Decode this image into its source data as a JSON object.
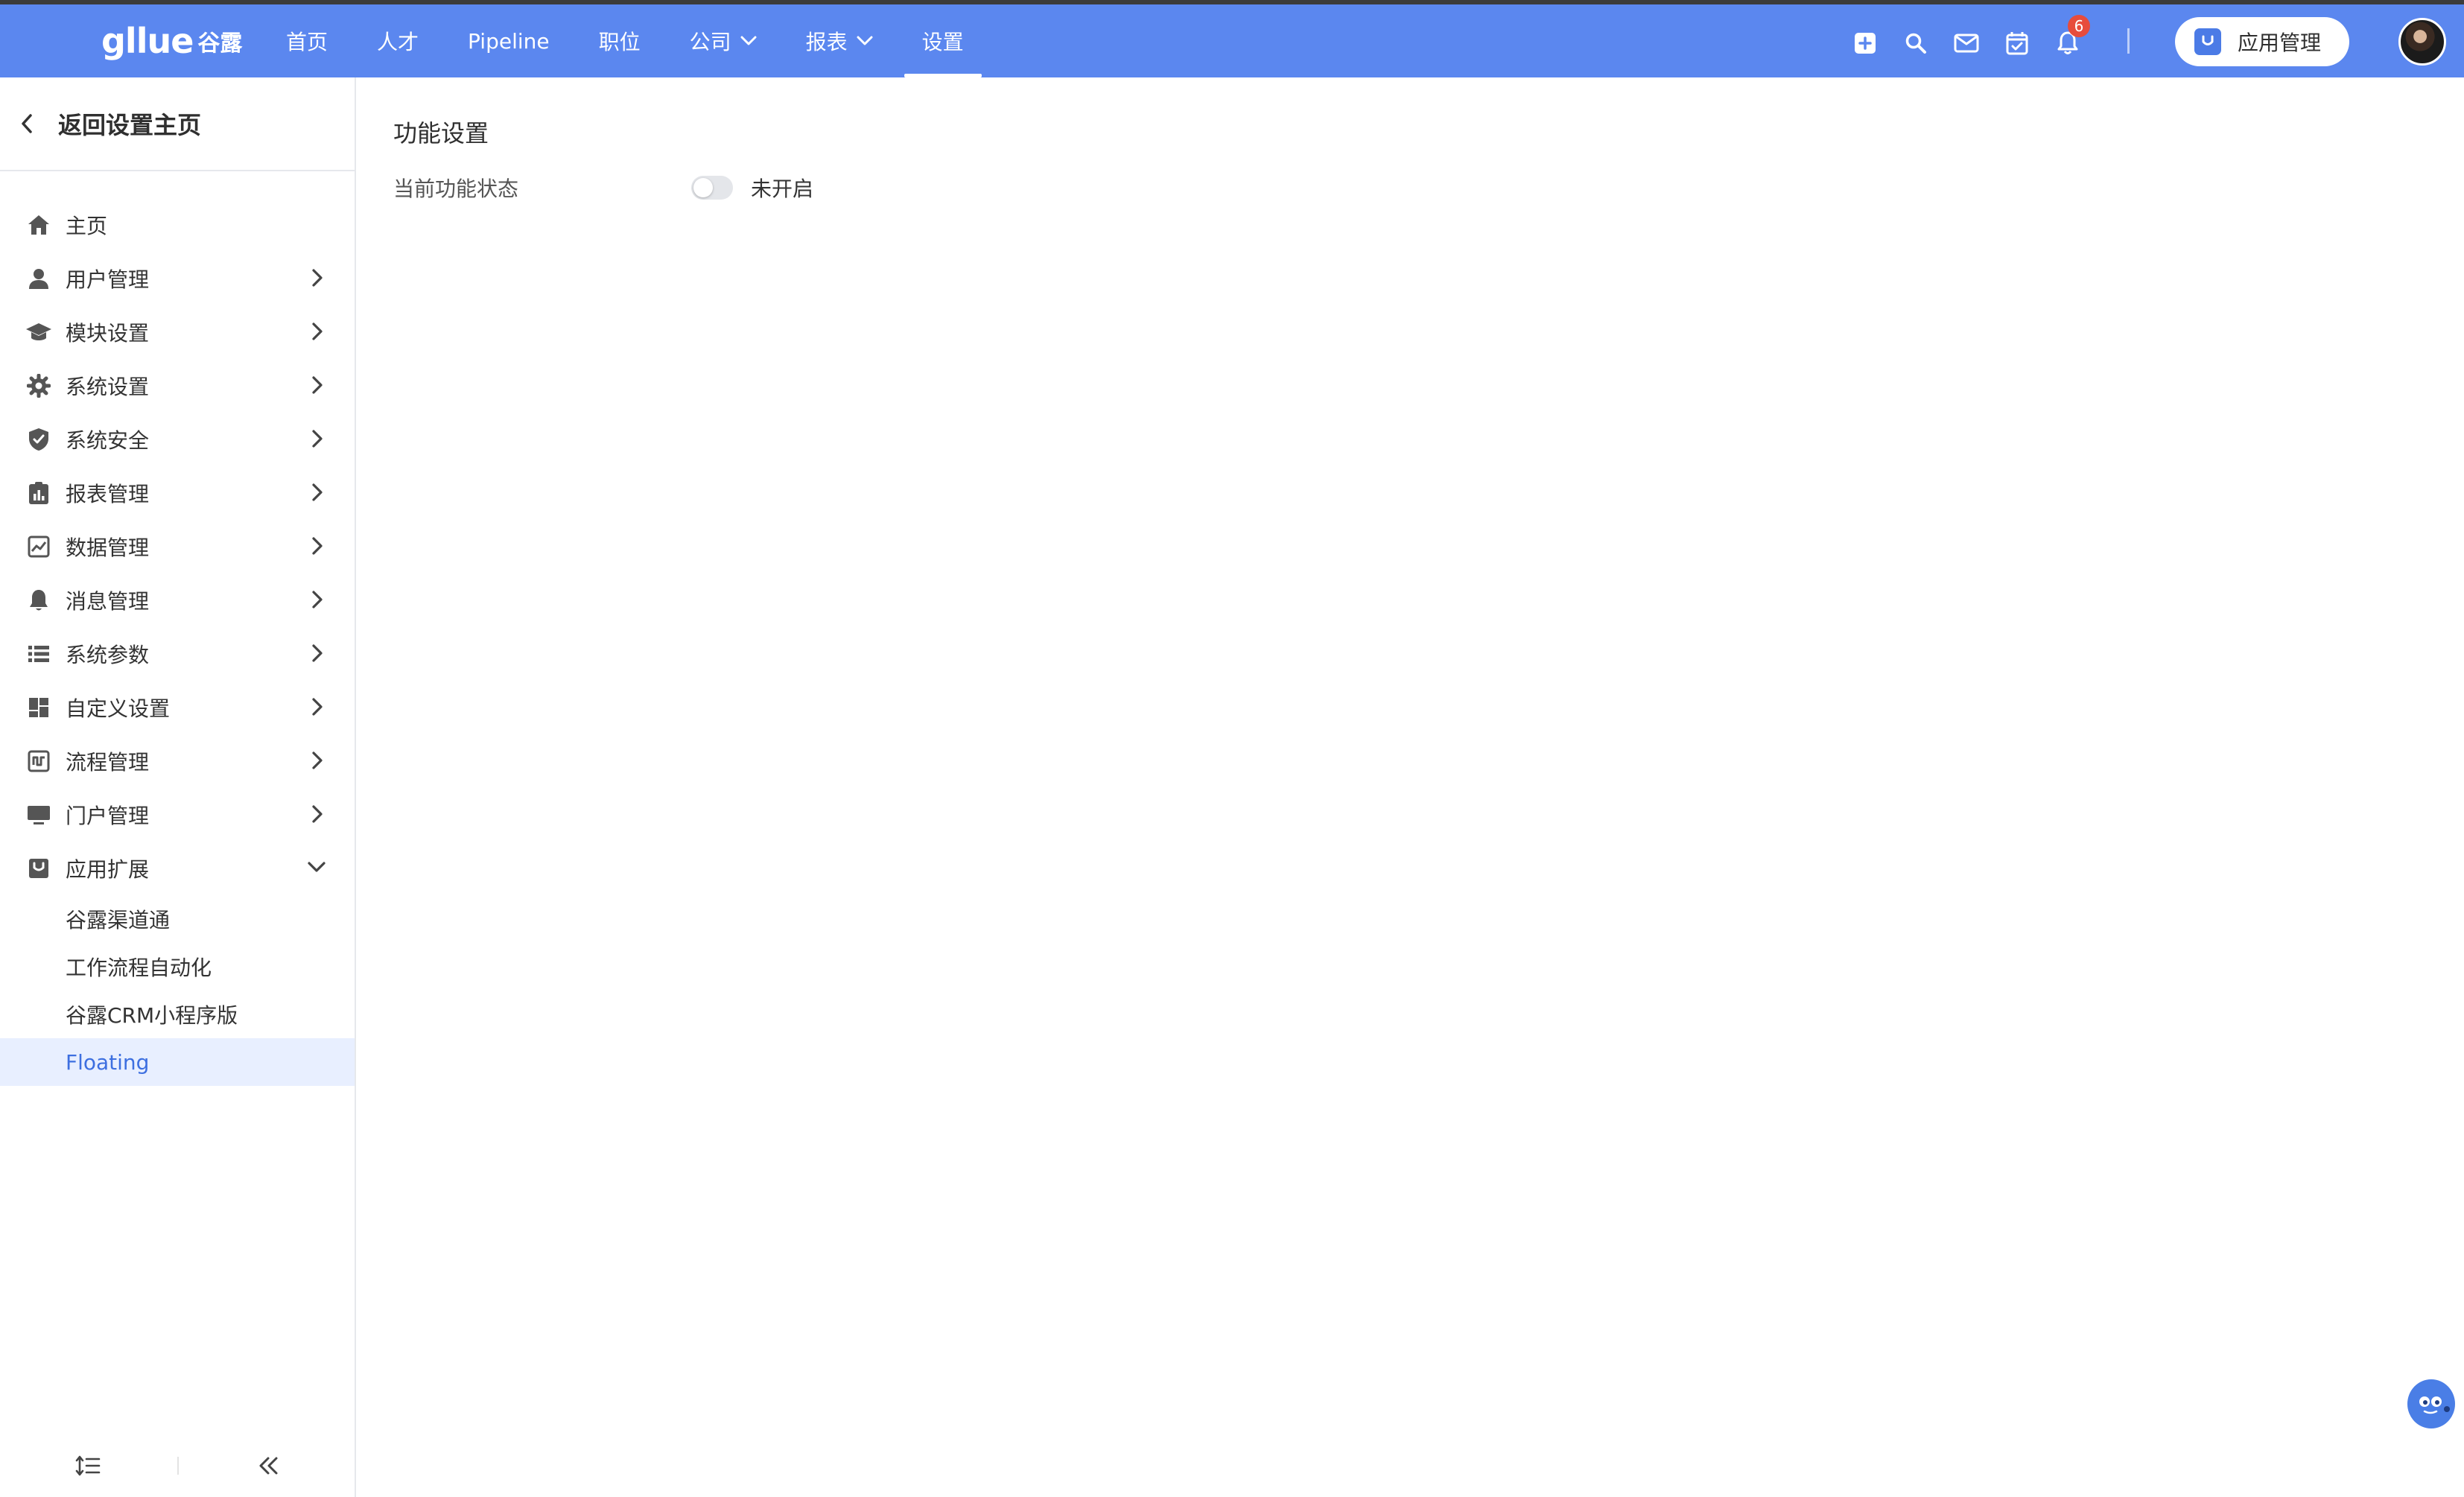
{
  "colors": {
    "topbar": "#5b87ef",
    "accent": "#3d6fe0",
    "active_bg": "#e8efff",
    "badge": "#e74c3c"
  },
  "logo": {
    "brand": "gllue",
    "sub": "谷露"
  },
  "nav": {
    "items": [
      {
        "label": "首页",
        "has_dropdown": false
      },
      {
        "label": "人才",
        "has_dropdown": false
      },
      {
        "label": "Pipeline",
        "has_dropdown": false
      },
      {
        "label": "职位",
        "has_dropdown": false
      },
      {
        "label": "公司",
        "has_dropdown": true
      },
      {
        "label": "报表",
        "has_dropdown": true
      },
      {
        "label": "设置",
        "has_dropdown": false,
        "active": true
      }
    ]
  },
  "header_actions": {
    "icons": [
      "add-icon",
      "search-icon",
      "mail-icon",
      "calendar-check-icon",
      "bell-icon"
    ],
    "notification_count": "6",
    "app_button_label": "应用管理"
  },
  "sidebar": {
    "back_label": "返回设置主页",
    "items": [
      {
        "label": "主页",
        "icon": "home-icon",
        "chevron": "none"
      },
      {
        "label": "用户管理",
        "icon": "user-icon",
        "chevron": "right"
      },
      {
        "label": "模块设置",
        "icon": "graduation-cap-icon",
        "chevron": "right"
      },
      {
        "label": "系统设置",
        "icon": "gear-icon",
        "chevron": "right"
      },
      {
        "label": "系统安全",
        "icon": "shield-check-icon",
        "chevron": "right"
      },
      {
        "label": "报表管理",
        "icon": "report-icon",
        "chevron": "right"
      },
      {
        "label": "数据管理",
        "icon": "chart-line-icon",
        "chevron": "right"
      },
      {
        "label": "消息管理",
        "icon": "bell-icon",
        "chevron": "right"
      },
      {
        "label": "系统参数",
        "icon": "list-icon",
        "chevron": "right"
      },
      {
        "label": "自定义设置",
        "icon": "dashboard-icon",
        "chevron": "right"
      },
      {
        "label": "流程管理",
        "icon": "workflow-icon",
        "chevron": "right"
      },
      {
        "label": "门户管理",
        "icon": "monitor-icon",
        "chevron": "right"
      },
      {
        "label": "应用扩展",
        "icon": "app-extension-icon",
        "chevron": "down"
      }
    ],
    "subitems": [
      {
        "label": "谷露渠道通",
        "active": false
      },
      {
        "label": "工作流程自动化",
        "active": false
      },
      {
        "label": "谷露CRM小程序版",
        "active": false
      },
      {
        "label": "Floating",
        "active": true
      }
    ]
  },
  "main": {
    "section_title": "功能设置",
    "status_label": "当前功能状态",
    "toggle_on": false,
    "toggle_text": "未开启"
  }
}
